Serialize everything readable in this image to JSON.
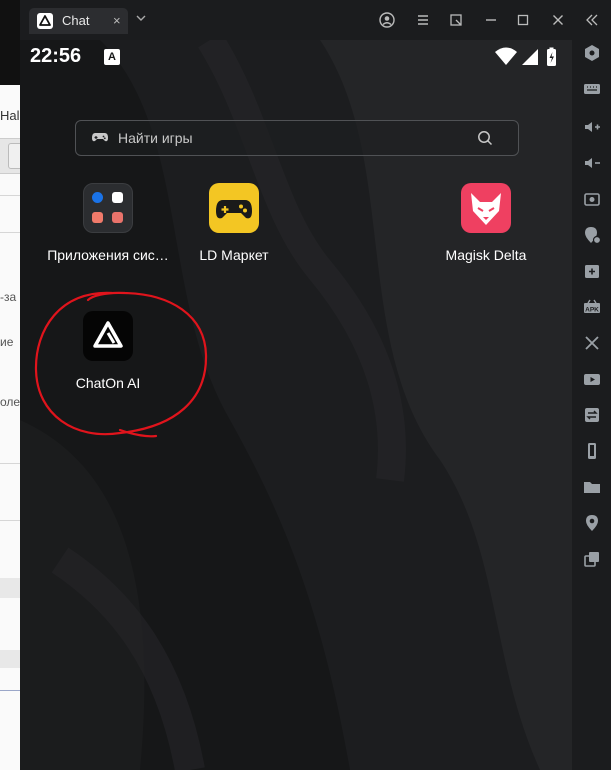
{
  "background_window": {
    "tab_text": "Hal",
    "text_lines": [
      "-за",
      "ие",
      "оле"
    ]
  },
  "titlebar": {
    "tab_title": "Chat",
    "tab_close": "×"
  },
  "statusbar": {
    "time": "22:56",
    "notif_badge": "A"
  },
  "search": {
    "placeholder": "Найти игры"
  },
  "apps": [
    {
      "label": "Приложения сис…"
    },
    {
      "label": "LD Маркет"
    },
    {
      "label": "Magisk Delta"
    },
    {
      "label": "ChatOn AI"
    }
  ],
  "colors": {
    "annotation_circle": "#e0141c",
    "ld_market_icon": "#f3c623",
    "magisk_icon": "#ef4061"
  }
}
